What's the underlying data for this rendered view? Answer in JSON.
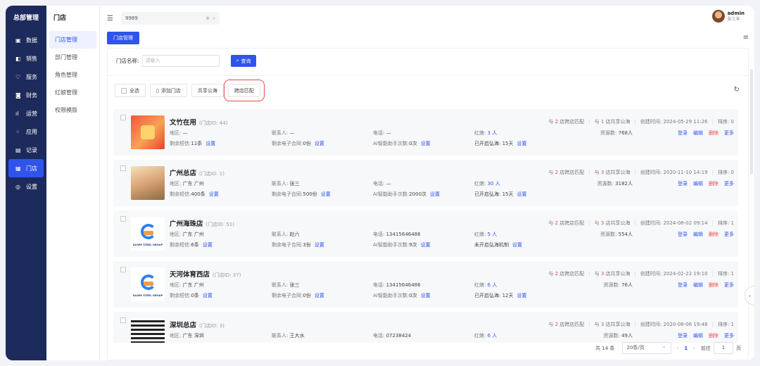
{
  "rail": {
    "title": "总部管理",
    "items": [
      {
        "icon": "chart-icon",
        "glyph": "▣",
        "label": "数据"
      },
      {
        "icon": "sales-icon",
        "glyph": "◧",
        "label": "销售"
      },
      {
        "icon": "heart-icon",
        "glyph": "♡",
        "label": "服务"
      },
      {
        "icon": "finance-icon",
        "glyph": "◙",
        "label": "财务"
      },
      {
        "icon": "operation-icon",
        "glyph": "ıl",
        "label": "运营"
      },
      {
        "icon": "apps-icon",
        "glyph": "⁘",
        "label": "应用"
      },
      {
        "icon": "record-icon",
        "glyph": "▤",
        "label": "记录"
      },
      {
        "icon": "store-icon",
        "glyph": "▦",
        "label": "门店"
      },
      {
        "icon": "settings-icon",
        "glyph": "◎",
        "label": "设置"
      }
    ],
    "active_index": 7
  },
  "submenu": {
    "title": "门店",
    "items": [
      "门店管理",
      "部门管理",
      "角色管理",
      "红娘管理",
      "权限模版"
    ],
    "active_index": 0
  },
  "topbar": {
    "search_value": "9989",
    "user_name": "admin",
    "user_sub": "张三丰"
  },
  "tab": {
    "label": "门店管理"
  },
  "filter": {
    "label": "门店名称:",
    "placeholder": "请输入",
    "query_label": "查询"
  },
  "toolbar": {
    "select_all": "全选",
    "add_store": "添加门店",
    "share_pool": "共享公海",
    "cross_match": "跨店匹配"
  },
  "stores": [
    {
      "name": "文竹在用",
      "store_id": "(门店ID: 44)",
      "thumb": "red",
      "region": "—",
      "contact": "—",
      "phone": "—",
      "matchmaker": "3 人",
      "sms": "11条",
      "contracts": "0份",
      "ai": "0次",
      "pool": "已开启弘海: 15天",
      "match_count": "2",
      "share_count": "1",
      "created": "创建时间: 2024-05-29 11:26",
      "sort": "排序: 0",
      "sources": "768人"
    },
    {
      "name": "广州总店",
      "store_id": "(门店ID: 1)",
      "thumb": "photo",
      "region": "广东  广州",
      "contact": "张三",
      "phone": "—",
      "matchmaker": "30 人",
      "sms": "400条",
      "contracts": "500份",
      "ai": "2000次",
      "pool": "已开启弘海: 15天",
      "match_count": "2",
      "share_count": "3",
      "created": "创建时间: 2020-11-10 14:19",
      "sort": "排序: 0",
      "sources": "3182人"
    },
    {
      "name": "广州海珠店",
      "store_id": "(门店ID: 51)",
      "thumb": "logo",
      "region": "广东  广州",
      "contact": "赵六",
      "phone": "13415646486",
      "matchmaker": "5 人",
      "sms": "6条",
      "contracts": "3份",
      "ai": "9次",
      "pool": "未开启弘海机制",
      "match_count": "2",
      "share_count": "3",
      "created": "创建时间: 2024-08-02 09:14",
      "sort": "排序: 1",
      "sources": "554人"
    },
    {
      "name": "天河体育西店",
      "store_id": "(门店ID: 37)",
      "thumb": "logo",
      "region": "广东  广州",
      "contact": "张三",
      "phone": "13415646486",
      "matchmaker": "6 人",
      "sms": "0条",
      "contracts": "0份",
      "ai": "0次",
      "pool": "已开启弘海: 12天",
      "match_count": "2",
      "share_count": "3",
      "created": "创建时间: 2024-02-22 19:10",
      "sort": "排序: 1",
      "sources": "76人"
    },
    {
      "name": "深圳总店",
      "store_id": "(门店ID: 3)",
      "thumb": "qr",
      "region": "广东  深圳",
      "contact": "王大水",
      "phone": "07238424",
      "matchmaker": "6 人",
      "sms": "",
      "contracts": "",
      "ai": "",
      "pool": "",
      "match_count": "2",
      "share_count": "3",
      "created": "创建时间: 2020-08-06 19:48",
      "sort": "排序: 1",
      "sources": "49人"
    }
  ],
  "labels": {
    "region": "地区:",
    "contact": "联系人:",
    "phone": "电话:",
    "matchmaker": "红娘:",
    "sms": "剩余短信:",
    "contracts": "剩余电子合同:",
    "ai": "AI智能助手次数:",
    "setting": "设置",
    "match_prefix": "与",
    "match_suffix": "店跨店匹配",
    "share_prefix": "与",
    "share_suffix": "店共享公海",
    "sources": "资源数:",
    "login": "登录",
    "edit": "编辑",
    "delete": "删除",
    "more": "更多",
    "logo_text": "GLORY STEEL GROUP"
  },
  "pager": {
    "total": "共 14 条",
    "page_size": "20条/页",
    "current": "1",
    "goto_label": "前往",
    "goto_value": "1",
    "page_unit": "页"
  }
}
